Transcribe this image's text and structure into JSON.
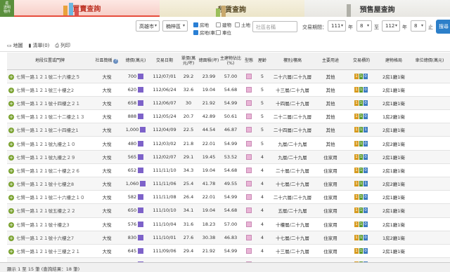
{
  "logo": {
    "line1": "莊",
    "line2": "透明",
    "line3": "物件"
  },
  "tabs": [
    {
      "label": "買賣查詢"
    },
    {
      "label": "租賃查詢"
    },
    {
      "label": "預售屋查詢"
    }
  ],
  "filters": {
    "city": "高雄市",
    "district": "楠梓區",
    "types": [
      {
        "label": "房地",
        "checked": true
      },
      {
        "label": "建物",
        "checked": false
      },
      {
        "label": "土地",
        "checked": false
      },
      {
        "label": "房地(車)",
        "checked": true
      },
      {
        "label": "車位",
        "checked": false
      }
    ],
    "community_placeholder": "社區名稱",
    "period_label": "交易期間：",
    "from_year": "111",
    "from_unit": "年",
    "from_month": "8",
    "to": "至",
    "to_year": "112",
    "to_unit": "年",
    "to_month": "8",
    "end_label": "止",
    "search_label": "搜尋"
  },
  "views": {
    "map": "地圖",
    "list": "清單(0)",
    "print": "列印"
  },
  "columns": [
    "地段位置或門牌",
    "社區簡稱",
    "總價(萬元)",
    "交易日期",
    "單價(萬元/坪)",
    "總面積(坪)",
    "主建物佔比(%)",
    "型態",
    "屋齡",
    "樓別/樓高",
    "主要用途",
    "交易標的",
    "建物格局",
    "車位總價(萬元)"
  ],
  "rows": [
    {
      "addr": "七賢一路１２１號二十六樓之５",
      "community": "大悅",
      "price": "700",
      "date": "112/07/01",
      "unit_price": "29.2",
      "area": "23.99",
      "ratio": "57.00",
      "age": "5",
      "floor": "二十六層/二十九層",
      "use": "其他",
      "tags": [
        "1",
        "1",
        "0"
      ],
      "layout": "2房1廳1衛",
      "parking": ""
    },
    {
      "addr": "七賢一路１２１號三十樓之2",
      "community": "大悅",
      "price": "620",
      "date": "112/06/24",
      "unit_price": "32.6",
      "area": "19.04",
      "ratio": "54.68",
      "age": "5",
      "floor": "十三層/二十九層",
      "use": "其他",
      "tags": [
        "1",
        "1",
        "0"
      ],
      "layout": "2房1廳1衛",
      "parking": ""
    },
    {
      "addr": "七賢一路１２１號十四樓之２１",
      "community": "大悅",
      "price": "658",
      "date": "112/06/07",
      "unit_price": "30",
      "area": "21.92",
      "ratio": "54.99",
      "age": "5",
      "floor": "十四層/二十九層",
      "use": "其他",
      "tags": [
        "1",
        "1",
        "0"
      ],
      "layout": "2房1廳1衛",
      "parking": ""
    },
    {
      "addr": "七賢一路１２１號二十二樓之１３",
      "community": "大悅",
      "price": "888",
      "date": "112/05/24",
      "unit_price": "20.7",
      "area": "42.89",
      "ratio": "50.61",
      "age": "5",
      "floor": "二十二層/二十九層",
      "use": "其他",
      "tags": [
        "1",
        "1",
        "0"
      ],
      "layout": "1房2廳1衛",
      "parking": ""
    },
    {
      "addr": "七賢一路１２１號二十四樓之1",
      "community": "大悅",
      "price": "1,000",
      "date": "112/04/09",
      "unit_price": "22.5",
      "area": "44.54",
      "ratio": "46.87",
      "age": "5",
      "floor": "二十四層/二十九層",
      "use": "其他",
      "tags": [
        "1",
        "1",
        "1"
      ],
      "layout": "2房1廳1衛",
      "parking": ""
    },
    {
      "addr": "七賢一路１２１號九樓之１０",
      "community": "大悅",
      "price": "480",
      "date": "112/03/02",
      "unit_price": "21.8",
      "area": "22.01",
      "ratio": "54.99",
      "age": "5",
      "floor": "九層/二十九層",
      "use": "其他",
      "tags": [
        "1",
        "1",
        "0"
      ],
      "layout": "2房2廳1衛",
      "parking": ""
    },
    {
      "addr": "七賢一路１２１號九樓之２９",
      "community": "大悅",
      "price": "565",
      "date": "112/02/07",
      "unit_price": "29.1",
      "area": "19.45",
      "ratio": "53.52",
      "age": "4",
      "floor": "九層/二十九層",
      "use": "住家用",
      "tags": [
        "1",
        "1",
        "0"
      ],
      "layout": "2房1廳1衛",
      "parking": ""
    },
    {
      "addr": "七賢一路１２１號二十樓之２６",
      "community": "大悅",
      "price": "652",
      "date": "111/11/10",
      "unit_price": "34.3",
      "area": "19.04",
      "ratio": "54.68",
      "age": "4",
      "floor": "二十層/二十九層",
      "use": "住家用",
      "tags": [
        "1",
        "1",
        "0"
      ],
      "layout": "2房1廳1衛",
      "parking": ""
    },
    {
      "addr": "七賢一路１２１號十七樓之8",
      "community": "大悅",
      "price": "1,060",
      "date": "111/11/06",
      "unit_price": "25.4",
      "area": "41.78",
      "ratio": "49.55",
      "age": "4",
      "floor": "十七層/二十九層",
      "use": "住家用",
      "tags": [
        "1",
        "1",
        "1"
      ],
      "layout": "2房2廳1衛",
      "parking": ""
    },
    {
      "addr": "七賢一路１２１號二十六樓之１０",
      "community": "大悅",
      "price": "582",
      "community2": "",
      "date": "111/11/08",
      "unit_price": "26.4",
      "area": "22.01",
      "ratio": "54.99",
      "age": "4",
      "floor": "二十六層/二十九層",
      "use": "住家用",
      "tags": [
        "1",
        "1",
        "0"
      ],
      "layout": "2房1廳1衛",
      "parking": ""
    },
    {
      "addr": "七賢一路１２１號五樓之２２",
      "community": "大悅",
      "price": "650",
      "date": "111/10/10",
      "unit_price": "34.1",
      "area": "19.04",
      "ratio": "54.68",
      "age": "4",
      "floor": "五層/二十九層",
      "use": "住家用",
      "tags": [
        "1",
        "1",
        "0"
      ],
      "layout": "2房1廳1衛",
      "parking": ""
    },
    {
      "addr": "七賢一路１２１號十樓之3",
      "community": "大悅",
      "price": "576",
      "date": "111/10/04",
      "unit_price": "31.6",
      "area": "18.23",
      "ratio": "57.00",
      "age": "4",
      "floor": "十樓層/二十九層",
      "use": "住家用",
      "tags": [
        "1",
        "1",
        "0"
      ],
      "layout": "2房1廳1衛",
      "parking": ""
    },
    {
      "addr": "七賢一路１２１號十六樓之7",
      "community": "大悅",
      "price": "830",
      "date": "111/10/01",
      "unit_price": "27.6",
      "area": "30.38",
      "ratio": "46.83",
      "age": "4",
      "floor": "十七層/二十九層",
      "use": "住家用",
      "tags": [
        "1",
        "1",
        "0"
      ],
      "layout": "1房2廳1衛",
      "parking": ""
    },
    {
      "addr": "七賢一路１２１號十三樓之２１",
      "community": "大悅",
      "price": "645",
      "date": "111/09/06",
      "unit_price": "29.4",
      "area": "21.92",
      "ratio": "54.99",
      "age": "4",
      "floor": "十三層/二十九層",
      "use": "住家用",
      "tags": [
        "1",
        "1",
        "0"
      ],
      "layout": "2房1廳1衛",
      "parking": ""
    },
    {
      "addr": "七賢一路１２１號四樓之２６",
      "community": "大悅",
      "price": "645",
      "date": "111/09/04",
      "unit_price": "33.9",
      "area": "19.04",
      "ratio": "54.68",
      "age": "4",
      "floor": "四層/二十九層",
      "use": "住家用",
      "tags": [
        "1",
        "1",
        "0"
      ],
      "layout": "2房1廳1衛",
      "parking": ""
    }
  ],
  "footer": "顯示 1 至 15 筆 (查詢結果：18 筆)",
  "colors": {
    "buy_accent": "#c0392b",
    "search_btn": "#2c7fc9",
    "price_badge": "#7d62c9"
  }
}
